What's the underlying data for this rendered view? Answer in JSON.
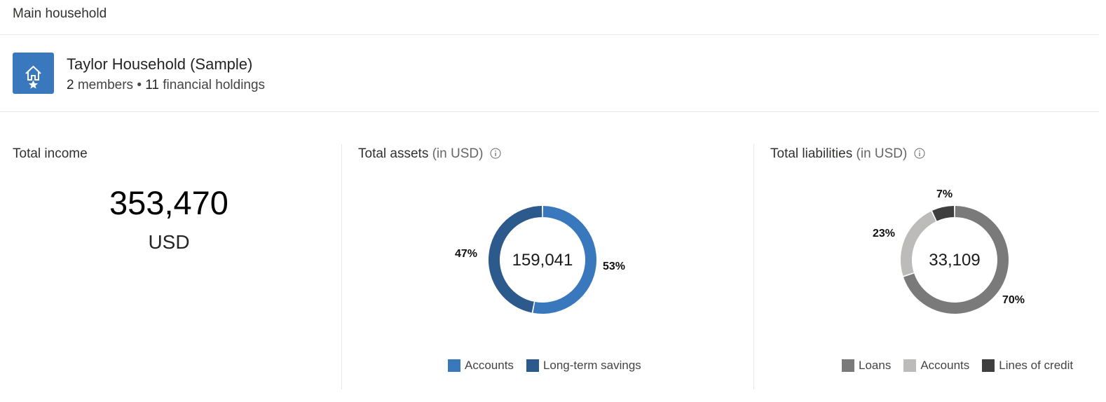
{
  "header": {
    "title": "Main household"
  },
  "household": {
    "name": "Taylor Household (Sample)",
    "members_count": "2",
    "members_label": "members",
    "separator": "•",
    "holdings_count": "11",
    "holdings_label": "financial holdings",
    "icon": "house-star-icon",
    "icon_color": "#3a78bd"
  },
  "income": {
    "title": "Total income",
    "value": "353,470",
    "unit": "USD"
  },
  "assets": {
    "title": "Total assets",
    "unit_label": "(in USD)",
    "total_label": "159,041",
    "info_icon": "info-icon",
    "slice_labels": [
      "53%",
      "47%"
    ],
    "legend": [
      "Accounts",
      "Long-term savings"
    ],
    "colors": [
      "#3a78bd",
      "#2c5a8c"
    ]
  },
  "liabilities": {
    "title": "Total liabilities",
    "unit_label": "(in USD)",
    "total_label": "33,109",
    "info_icon": "info-icon",
    "slice_labels": [
      "70%",
      "23%",
      "7%"
    ],
    "legend": [
      "Loans",
      "Accounts",
      "Lines of credit"
    ],
    "colors": [
      "#7a7a7a",
      "#bdbbb9",
      "#3e3e3e"
    ]
  },
  "chart_data": [
    {
      "type": "pie",
      "title": "Total assets (in USD)",
      "center_label": "159,041",
      "categories": [
        "Accounts",
        "Long-term savings"
      ],
      "values": [
        53,
        47
      ],
      "value_unit": "%"
    },
    {
      "type": "pie",
      "title": "Total liabilities (in USD)",
      "center_label": "33,109",
      "categories": [
        "Loans",
        "Accounts",
        "Lines of credit"
      ],
      "values": [
        70,
        23,
        7
      ],
      "value_unit": "%"
    }
  ]
}
